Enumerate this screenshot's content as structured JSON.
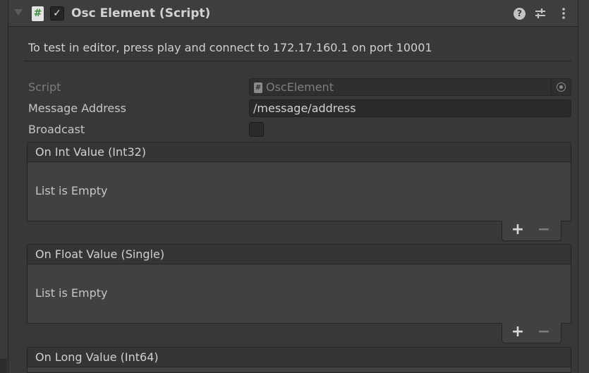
{
  "component": {
    "title": "Osc Element (Script)",
    "script_icon_glyph": "#",
    "enabled": true
  },
  "info": {
    "text": "To test in editor, press play and connect to 172.17.160.1 on port 10001"
  },
  "properties": {
    "script_label": "Script",
    "script_value": "OscElement",
    "message_address_label": "Message Address",
    "message_address_value": "/message/address",
    "broadcast_label": "Broadcast",
    "broadcast_value": false
  },
  "events": [
    {
      "title": "On Int Value (Int32)",
      "empty_text": "List is Empty"
    },
    {
      "title": "On Float Value (Single)",
      "empty_text": "List is Empty"
    },
    {
      "title": "On Long Value (Int64)"
    }
  ],
  "list_buttons": {
    "add": "+",
    "remove": "−"
  },
  "icons": {
    "foldout": "triangle-down-icon",
    "help": "help-icon",
    "presets": "sliders-icon",
    "more": "kebab-menu-icon",
    "object_picker": "target-circle-icon"
  },
  "colors": {
    "background": "#383838",
    "header": "#3e3e3e",
    "field": "#2a2a2a",
    "script_icon_green": "#3c8a3c"
  }
}
